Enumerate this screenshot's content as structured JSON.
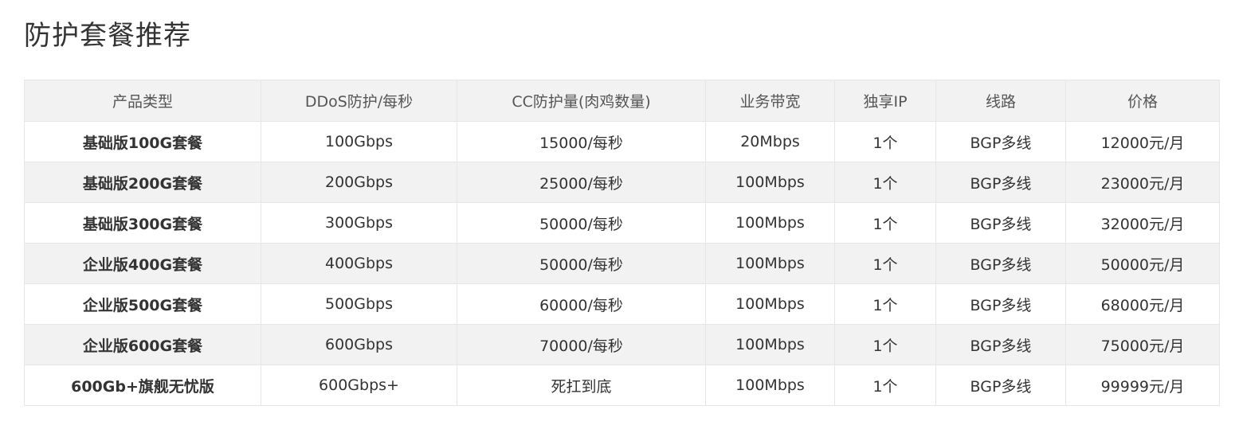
{
  "page": {
    "title": "防护套餐推荐"
  },
  "table": {
    "headers": [
      "产品类型",
      "DDoS防护/每秒",
      "CC防护量(肉鸡数量)",
      "业务带宽",
      "独享IP",
      "线路",
      "价格"
    ],
    "rows": [
      [
        "基础版100G套餐",
        "100Gbps",
        "15000/每秒",
        "20Mbps",
        "1个",
        "BGP多线",
        "12000元/月"
      ],
      [
        "基础版200G套餐",
        "200Gbps",
        "25000/每秒",
        "100Mbps",
        "1个",
        "BGP多线",
        "23000元/月"
      ],
      [
        "基础版300G套餐",
        "300Gbps",
        "50000/每秒",
        "100Mbps",
        "1个",
        "BGP多线",
        "32000元/月"
      ],
      [
        "企业版400G套餐",
        "400Gbps",
        "50000/每秒",
        "100Mbps",
        "1个",
        "BGP多线",
        "50000元/月"
      ],
      [
        "企业版500G套餐",
        "500Gbps",
        "60000/每秒",
        "100Mbps",
        "1个",
        "BGP多线",
        "68000元/月"
      ],
      [
        "企业版600G套餐",
        "600Gbps",
        "70000/每秒",
        "100Mbps",
        "1个",
        "BGP多线",
        "75000元/月"
      ],
      [
        "600Gb+旗舰无忧版",
        "600Gbps+",
        "死扛到底",
        "100Mbps",
        "1个",
        "BGP多线",
        "99999元/月"
      ]
    ]
  },
  "colors": {
    "text": "#333333",
    "header_bg": "#f2f2f2",
    "stripe_bg": "#f2f2f2",
    "border": "#e6e6e6"
  }
}
